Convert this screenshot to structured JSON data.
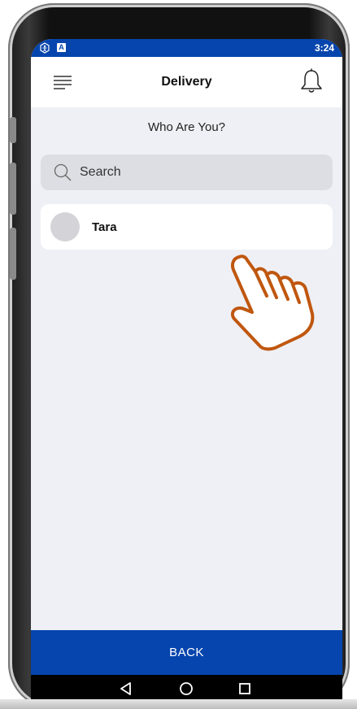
{
  "status_bar": {
    "icons": [
      "accessibility-icon",
      "notification-a-icon"
    ],
    "notification_letter": "A",
    "time": "3:24",
    "color": "#0645ad"
  },
  "app_bar": {
    "title": "Delivery",
    "icons": [
      "menu-icon",
      "bell-icon"
    ]
  },
  "prompt": "Who Are You?",
  "search": {
    "placeholder": "Search",
    "icon": "search-icon"
  },
  "users": [
    {
      "name": "Tara",
      "avatar": "avatar-placeholder"
    }
  ],
  "overlay": {
    "icon": "pointing-hand-icon",
    "color": "#c0570f"
  },
  "footer": {
    "back_label": "BACK",
    "color": "#0645ad"
  },
  "nav_bar": {
    "icons": [
      "back-triangle-icon",
      "home-circle-icon",
      "recents-square-icon"
    ]
  }
}
